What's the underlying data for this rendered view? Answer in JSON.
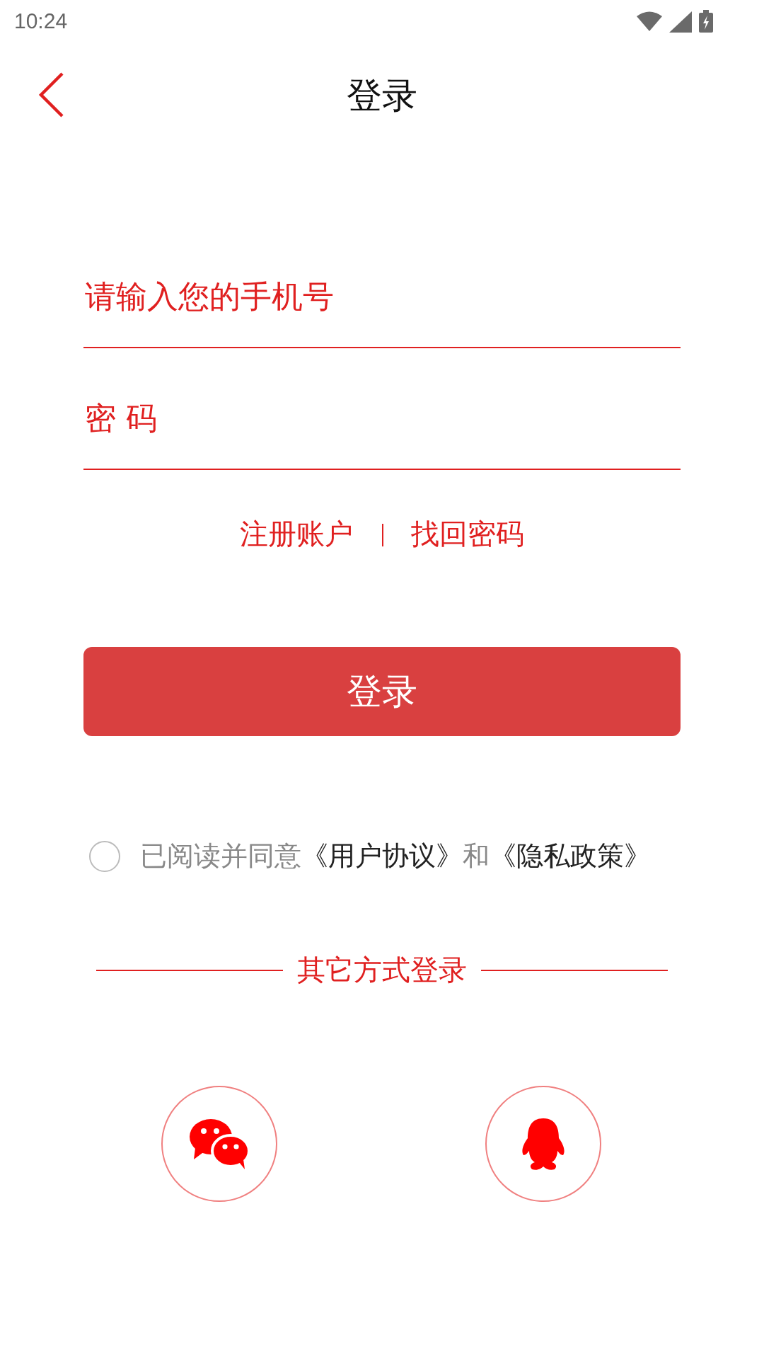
{
  "status_bar": {
    "time": "10:24"
  },
  "header": {
    "title": "登录"
  },
  "form": {
    "phone": {
      "placeholder": "请输入您的手机号"
    },
    "password": {
      "placeholder": "密 码"
    }
  },
  "links": [
    {
      "label": "注册账户"
    },
    {
      "label": "找回密码"
    }
  ],
  "login_button": {
    "label": "登录"
  },
  "agreement": {
    "checked": false,
    "parts": [
      {
        "kind": "text",
        "text": "已阅读并同意"
      },
      {
        "kind": "link",
        "text": "《用户协议》"
      },
      {
        "kind": "text",
        "text": "和"
      },
      {
        "kind": "link",
        "text": "《隐私政策》"
      }
    ]
  },
  "other_login": {
    "title": "其它方式登录",
    "options": [
      {
        "kind": "wechat"
      },
      {
        "kind": "qq"
      }
    ]
  }
}
